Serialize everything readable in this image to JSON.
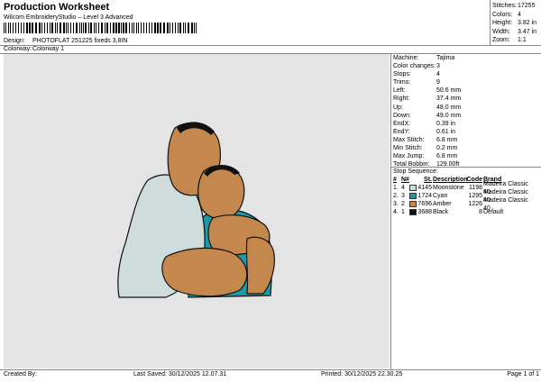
{
  "header": {
    "title": "Production Worksheet",
    "subtitle": "Wilcom EmbroideryStudio – Level 3 Advanced",
    "design_label": "Design:",
    "design_value": "PHOTOFLAT 251225 fixeds 3,8IN",
    "colorway_label": "Colorway:",
    "colorway_value": "Colorway 1"
  },
  "stats": [
    {
      "label": "Stitches:",
      "value": "17255"
    },
    {
      "label": "Colors:",
      "value": "4"
    },
    {
      "label": "Height:",
      "value": "3.82 in"
    },
    {
      "label": "Width:",
      "value": "3.47 in"
    },
    {
      "label": "Zoom:",
      "value": "1:1"
    }
  ],
  "machine_info": [
    {
      "label": "Machine:",
      "value": "Tajima"
    },
    {
      "label": "Color changes:",
      "value": "3"
    },
    {
      "label": "Stops:",
      "value": "4"
    },
    {
      "label": "Trims:",
      "value": "9"
    },
    {
      "label": "Left:",
      "value": "50.6 mm"
    },
    {
      "label": "Right:",
      "value": "37.4 mm"
    },
    {
      "label": "Up:",
      "value": "48.0 mm"
    },
    {
      "label": "Down:",
      "value": "49.0 mm"
    },
    {
      "label": "EndX:",
      "value": "0.39 in"
    },
    {
      "label": "EndY:",
      "value": "0.61 in"
    },
    {
      "label": "Max Stitch:",
      "value": "6.8 mm"
    },
    {
      "label": "Min Stitch:",
      "value": "0.2 mm"
    },
    {
      "label": "Max Jump:",
      "value": "6.8 mm"
    },
    {
      "label": "Total Bobbin:",
      "value": "129.00ft"
    }
  ],
  "stop_sequence": {
    "heading": "Stop Sequence:",
    "columns": {
      "idx": "#",
      "nf": "N#",
      "st": "St.",
      "desc": "Description",
      "code": "Code",
      "brand": "Brand"
    },
    "rows": [
      {
        "idx": "1.",
        "nf": "4",
        "color": "#cfdcdc",
        "st": "4145",
        "desc": "Moonstone",
        "code": "1198",
        "brand": "Madeira Classic 40"
      },
      {
        "idx": "2.",
        "nf": "3",
        "color": "#1b9aa8",
        "st": "1724",
        "desc": "Cyan",
        "code": "1295",
        "brand": "Madeira Classic 40"
      },
      {
        "idx": "3.",
        "nf": "2",
        "color": "#c4884e",
        "st": "7696",
        "desc": "Amber",
        "code": "1226",
        "brand": "Madeira Classic 40"
      },
      {
        "idx": "4.",
        "nf": "1",
        "color": "#111111",
        "st": "3688",
        "desc": "Black",
        "code": "8",
        "brand": "Default"
      }
    ]
  },
  "footer": {
    "created_by": "Created By:",
    "last_saved": "Last Saved: 30/12/2025 12.07.31",
    "printed": "Printed: 30/12/2025 22.30.25",
    "page": "Page 1 of 1"
  },
  "colors": {
    "canvas_bg": "#e4e4e4",
    "skin": "#c4884e",
    "shirt": "#cfdcdc",
    "teal": "#1b9aa8",
    "outline": "#111111"
  }
}
